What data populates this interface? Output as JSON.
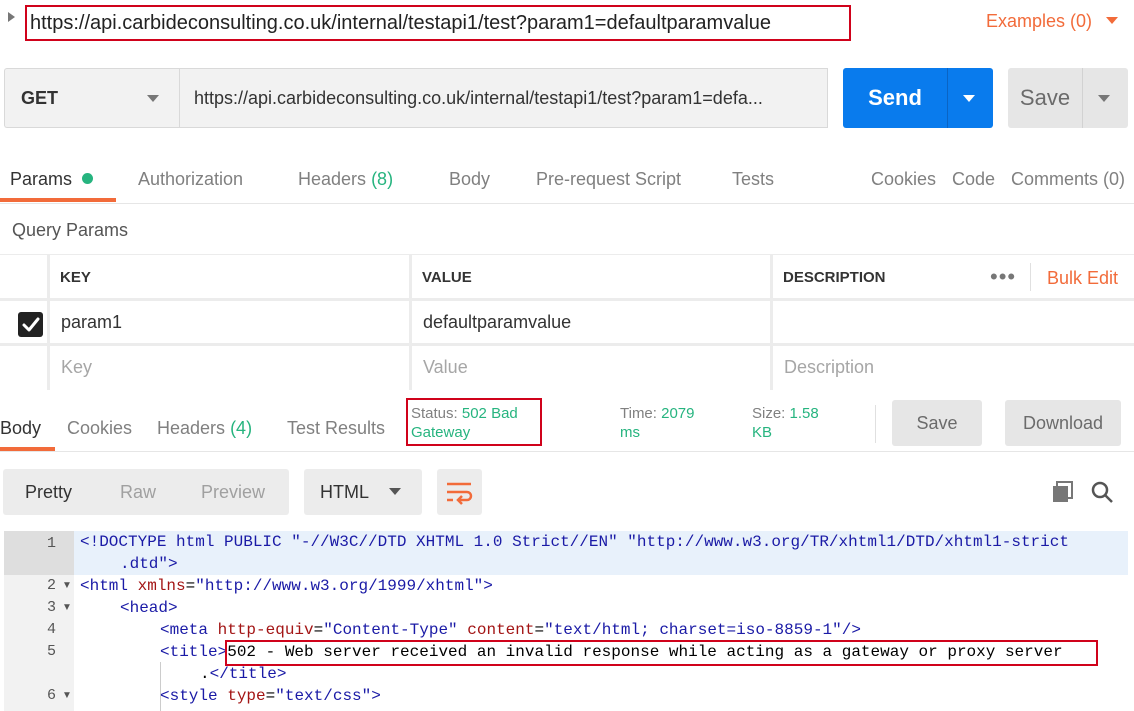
{
  "request_title": "https://api.carbideconsulting.co.uk/internal/testapi1/test?param1=defaultparamvalue",
  "examples_label": "Examples (0)",
  "method": "GET",
  "url": "https://api.carbideconsulting.co.uk/internal/testapi1/test?param1=defa...",
  "send_label": "Send",
  "save_label": "Save",
  "request_tabs": {
    "params": "Params",
    "authorization": "Authorization",
    "headers": "Headers",
    "headers_count": "(8)",
    "body": "Body",
    "prerequest": "Pre-request Script",
    "tests": "Tests"
  },
  "request_links": {
    "cookies": "Cookies",
    "code": "Code",
    "comments": "Comments (0)"
  },
  "query_params": {
    "title": "Query Params",
    "columns": {
      "key": "KEY",
      "value": "VALUE",
      "description": "DESCRIPTION"
    },
    "bulk_edit": "Bulk Edit",
    "row": {
      "key": "param1",
      "value": "defaultparamvalue",
      "description": ""
    },
    "placeholder": {
      "key": "Key",
      "value": "Value",
      "description": "Description"
    }
  },
  "response_tabs": {
    "body": "Body",
    "cookies": "Cookies",
    "headers": "Headers",
    "headers_count": "(4)",
    "test_results": "Test Results"
  },
  "response_meta": {
    "status_label": "Status:",
    "status_value_1": "502 Bad",
    "status_value_2": "Gateway",
    "time_label": "Time:",
    "time_value_1": "2079",
    "time_value_2": "ms",
    "size_label": "Size:",
    "size_value_1": "1.58",
    "size_value_2": "KB",
    "save_label": "Save",
    "download_label": "Download"
  },
  "view_options": {
    "pretty": "Pretty",
    "raw": "Raw",
    "preview": "Preview",
    "format": "HTML"
  },
  "code": {
    "line_numbers": [
      "1",
      "2",
      "3",
      "4",
      "5",
      "6"
    ],
    "l1a_tag": "<!DOCTYPE html PUBLIC ",
    "l1a_str1": "\"-//W3C//DTD XHTML 1.0 Strict//EN\"",
    "l1a_str2": " \"http://www.w3.org/TR/xhtml1/DTD/xhtml1-strict",
    "l1b_str": ".dtd\"",
    "l1b_tag": ">",
    "l2_tag": "<html ",
    "l2_attr": "xmlns",
    "l2_eq": "=",
    "l2_val": "\"http://www.w3.org/1999/xhtml\"",
    "l2_close": ">",
    "l3_tag": "<head>",
    "l4_tag": "<meta ",
    "l4_attr1": "http-equiv",
    "l4_eq1": "=",
    "l4_val1": "\"Content-Type\"",
    "l4_sp": " ",
    "l4_attr2": "content",
    "l4_eq2": "=",
    "l4_val2": "\"text/html; charset=iso-8859-1\"",
    "l4_close": "/>",
    "l5_tag": "<title>",
    "l5_text": "502 - Web server received an invalid response while acting as a gateway or proxy server",
    "l5b_text": ".",
    "l5b_tag": "</title>",
    "l6_tag": "<style ",
    "l6_attr": "type",
    "l6_eq": "=",
    "l6_val": "\"text/css\"",
    "l6_close": ">"
  },
  "colors": {
    "accent": "#f26b3a",
    "send": "#097bed",
    "status_ok_text": "#26b47f",
    "highlight_box": "#d0021b"
  }
}
